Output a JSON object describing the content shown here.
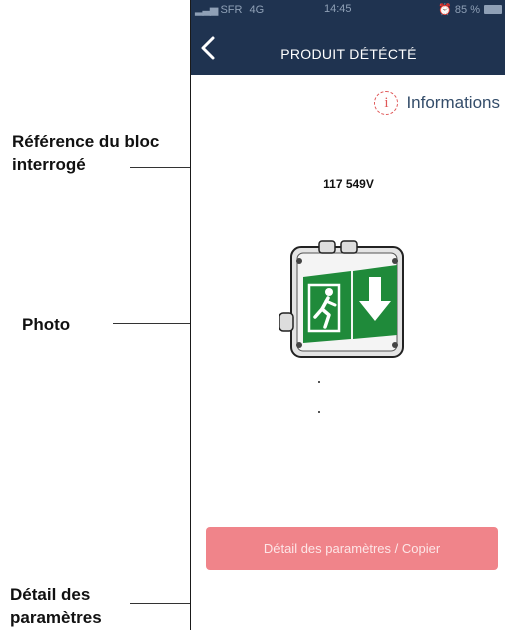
{
  "status_bar": {
    "carrier": "SFR",
    "network": "4G",
    "time": "14:45",
    "battery": "85 %"
  },
  "nav": {
    "title": "PRODUIT DÉTÉCTÉ",
    "back_icon": "chevron-left-icon"
  },
  "info": {
    "label": "Informations",
    "icon": "info-icon",
    "icon_color": "#e05858"
  },
  "product": {
    "reference": "117 549V",
    "photo": "emergency-exit-sign"
  },
  "detail_button": {
    "label": "Détail des paramètres / Copier",
    "color": "#f0848a"
  },
  "annotations": {
    "reference_label": "Référence du bloc interrogé",
    "photo_label": "Photo",
    "detail_label": "Détail des paramètres"
  },
  "colors": {
    "nav_background": "#1f3350",
    "sign_green": "#1f8a3a"
  }
}
